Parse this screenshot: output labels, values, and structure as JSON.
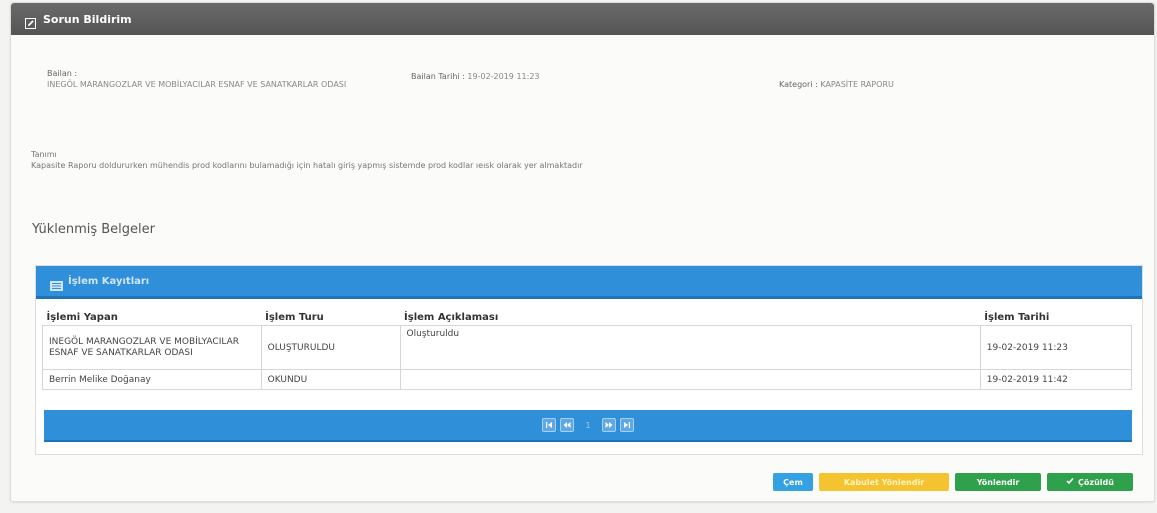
{
  "window": {
    "title": "Sorun Bildirim",
    "icon": "edit-icon"
  },
  "info": {
    "basvuran_label": "Bailan :",
    "basvuran_value": "INEGÖL MARANGOZLAR VE MOBİLYACILAR ESNAF VE SANATKARLAR ODASI",
    "tarih_label": "Bailan Tarihi :",
    "tarih_value": "19-02-2019 11:23",
    "kategori_label": "Kategori :",
    "kategori_value": "KAPASİTE RAPORU"
  },
  "description": {
    "label": "Tanımı",
    "text": "Kapasite Raporu doldururken mühendis prod kodlarını bulamadığı için hatalı giriş yapmış sistemde prod kodlar ıeısk olarak yer almaktadır"
  },
  "documents": {
    "title": "Yüklenmiş Belgeler"
  },
  "records": {
    "title": "İşlem Kayıtları",
    "icon": "list-icon",
    "columns": [
      "İşlemi Yapan",
      "İşlem Turu",
      "İşlem Açıklaması",
      "İşlem Tarihi"
    ],
    "rows": [
      {
        "yapan": "INEGÖL MARANGOZLAR VE MOBİLYACILAR ESNAF VE SANATKARLAR ODASI",
        "turu": "OLUŞTURULDU",
        "aciklama": "Oluşturuldu",
        "tarih": "19-02-2019 11:23"
      },
      {
        "yapan": "Berrin Melike Doğanay",
        "turu": "OKUNDU",
        "aciklama": "",
        "tarih": "19-02-2019 11:42"
      }
    ],
    "pager": {
      "first": "first-page-icon",
      "prev": "prev-page-icon",
      "current": "1",
      "next": "next-page-icon",
      "last": "last-page-icon"
    }
  },
  "actions": {
    "close": "Çem",
    "accept": "Kabulet Yönlendir",
    "forward": "Yönlendir",
    "solved": "Çözüldü"
  },
  "colors": {
    "header_bar": "#5e5e5e",
    "grid_blue": "#2f8fd8",
    "close_blue": "#34a2e2",
    "accept_yellow": "#f4c430",
    "green": "#2fa04b"
  }
}
